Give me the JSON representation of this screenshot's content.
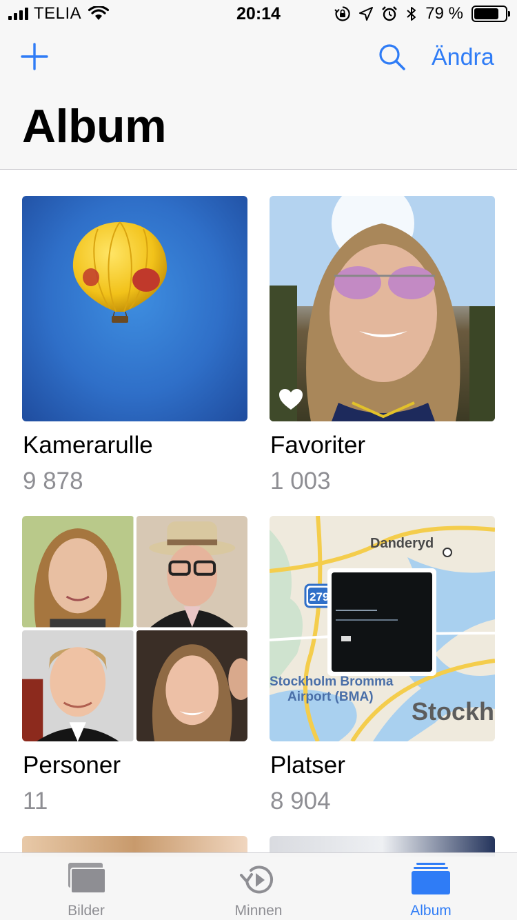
{
  "status_bar": {
    "carrier": "TELIA",
    "time": "20:14",
    "battery_percent": "79 %",
    "battery_level": 0.79,
    "icons": [
      "signal-icon",
      "wifi-icon",
      "orientation-lock-icon",
      "location-icon",
      "alarm-icon",
      "bluetooth-icon",
      "battery-icon"
    ]
  },
  "nav": {
    "title": "Album",
    "edit_label": "Ändra",
    "add_icon": "plus-icon",
    "search_icon": "search-icon"
  },
  "albums": [
    {
      "title": "Kamerarulle",
      "count": "9 878"
    },
    {
      "title": "Favoriter",
      "count": "1 003"
    },
    {
      "title": "Personer",
      "count": "11"
    },
    {
      "title": "Platser",
      "count": "8 904"
    }
  ],
  "map": {
    "labels": [
      "Danderyd",
      "279",
      "Stockholm Bromma",
      "Airport (BMA)",
      "Stockh"
    ]
  },
  "tabs": [
    {
      "label": "Bilder",
      "icon": "photos-icon",
      "active": false
    },
    {
      "label": "Minnen",
      "icon": "memories-icon",
      "active": false
    },
    {
      "label": "Album",
      "icon": "album-icon",
      "active": true
    }
  ],
  "colors": {
    "accent": "#2f7cf6",
    "secondary_text": "#8e8e93",
    "bar_bg": "#f7f7f7"
  }
}
